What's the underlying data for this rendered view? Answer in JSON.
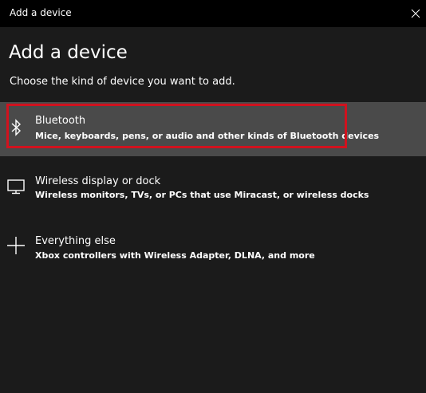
{
  "window": {
    "title": "Add a device"
  },
  "header": {
    "heading": "Add a device",
    "instructions": "Choose the kind of device you want to add."
  },
  "options": [
    {
      "name": "Bluetooth",
      "description": "Mice, keyboards, pens, or audio and other kinds of Bluetooth devices",
      "icon": "bluetooth-icon",
      "selected": true
    },
    {
      "name": "Wireless display or dock",
      "description": "Wireless monitors, TVs, or PCs that use Miracast, or wireless docks",
      "icon": "monitor-icon",
      "selected": false
    },
    {
      "name": "Everything else",
      "description": "Xbox controllers with Wireless Adapter, DLNA, and more",
      "icon": "plus-icon",
      "selected": false
    }
  ],
  "colors": {
    "window_background": "#1b1b1b",
    "titlebar_background": "#000000",
    "selected_background": "#4a4a4a",
    "highlight_border": "#d1121e",
    "text": "#ffffff"
  }
}
